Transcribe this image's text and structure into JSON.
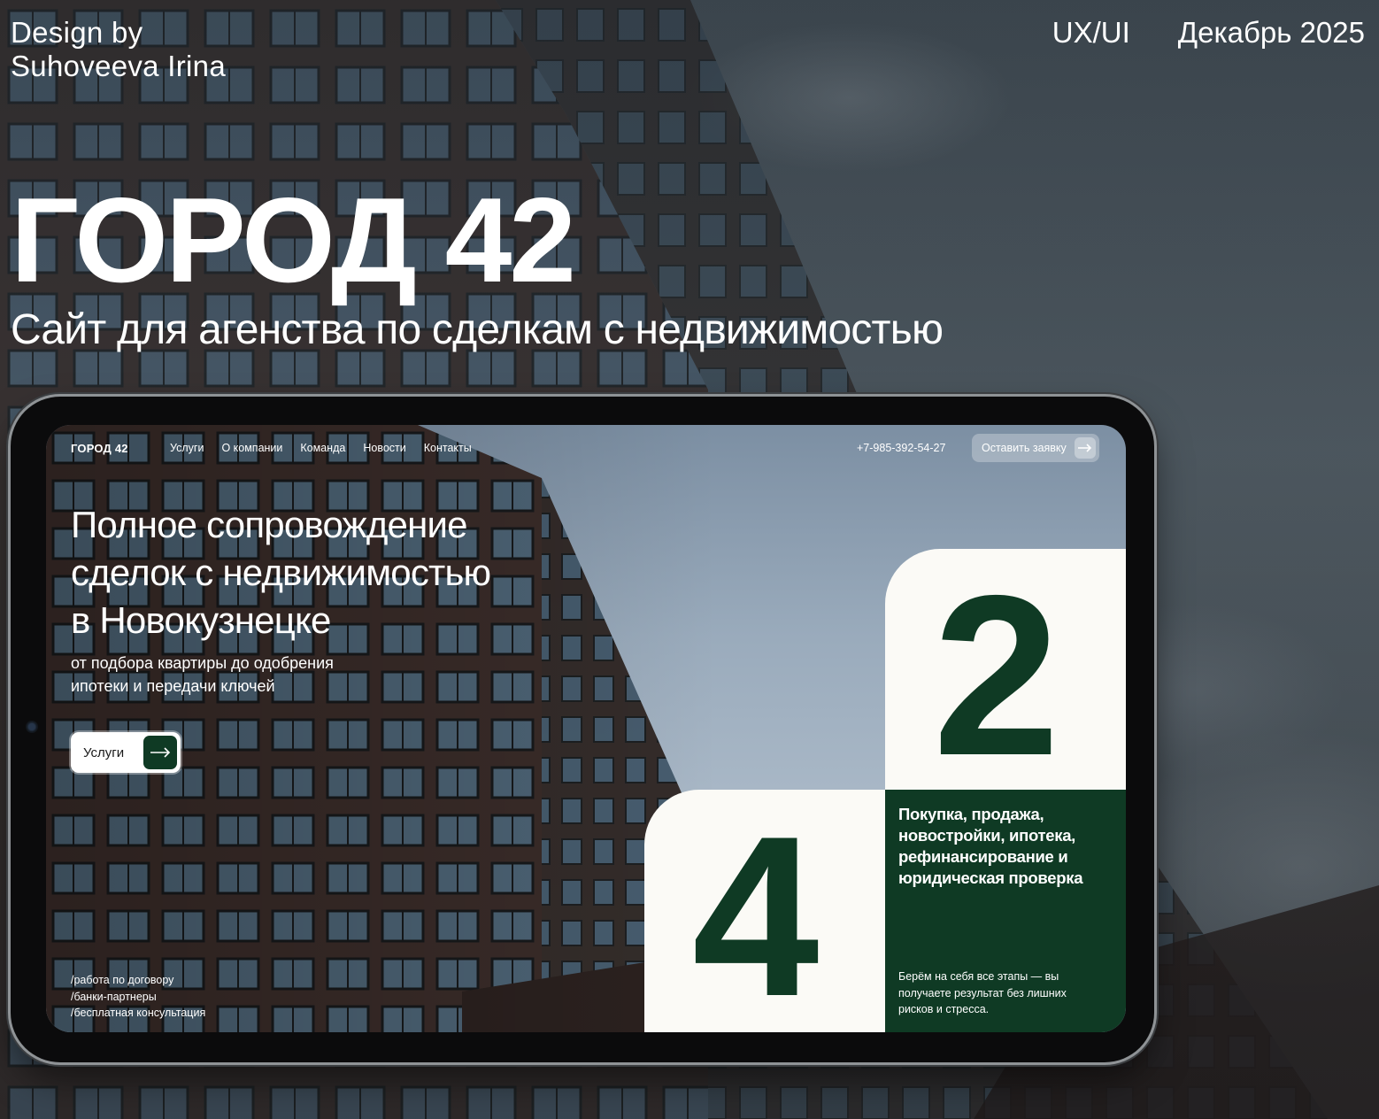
{
  "header": {
    "author_line1": "Design by",
    "author_line2": "Suhoveeva Irina",
    "tag": "UX/UI",
    "date": "Декабрь 2025"
  },
  "project": {
    "title": "ГОРОД 42",
    "subtitle": "Сайт для агенства по сделкам с недвижимостью"
  },
  "site": {
    "logo": "ГОРОД 42",
    "nav": [
      "Услуги",
      "О компании",
      "Команда",
      "Новости",
      "Контакты"
    ],
    "phone": "+7-985-392-54-27",
    "cta_label": "Оставить заявку",
    "hero_title": [
      "Полное сопровождение",
      "сделок с недвижимостью",
      "в Новокузнецке"
    ],
    "hero_sub": [
      "от подбора квартиры до одобрения",
      "ипотеки и передачи ключей"
    ],
    "services_button": "Услуги",
    "features": [
      "/работа по договору",
      "/банки-партнеры",
      "/бесплатная консультация"
    ],
    "digit_2": "2",
    "digit_4": "4",
    "card_title": [
      "Покупка, продажа,",
      "новостройки, ипотека,",
      "рефинансирование и",
      "юридическая проверка"
    ],
    "card_text": [
      "Берём на себя все этапы — вы",
      "получаете результат без лишних",
      "рисков и стресса."
    ]
  },
  "colors": {
    "brand_green": "#0f3a24",
    "card_white": "#fbfaf6"
  },
  "icons": [
    "arrow-right-icon",
    "camera-icon"
  ]
}
